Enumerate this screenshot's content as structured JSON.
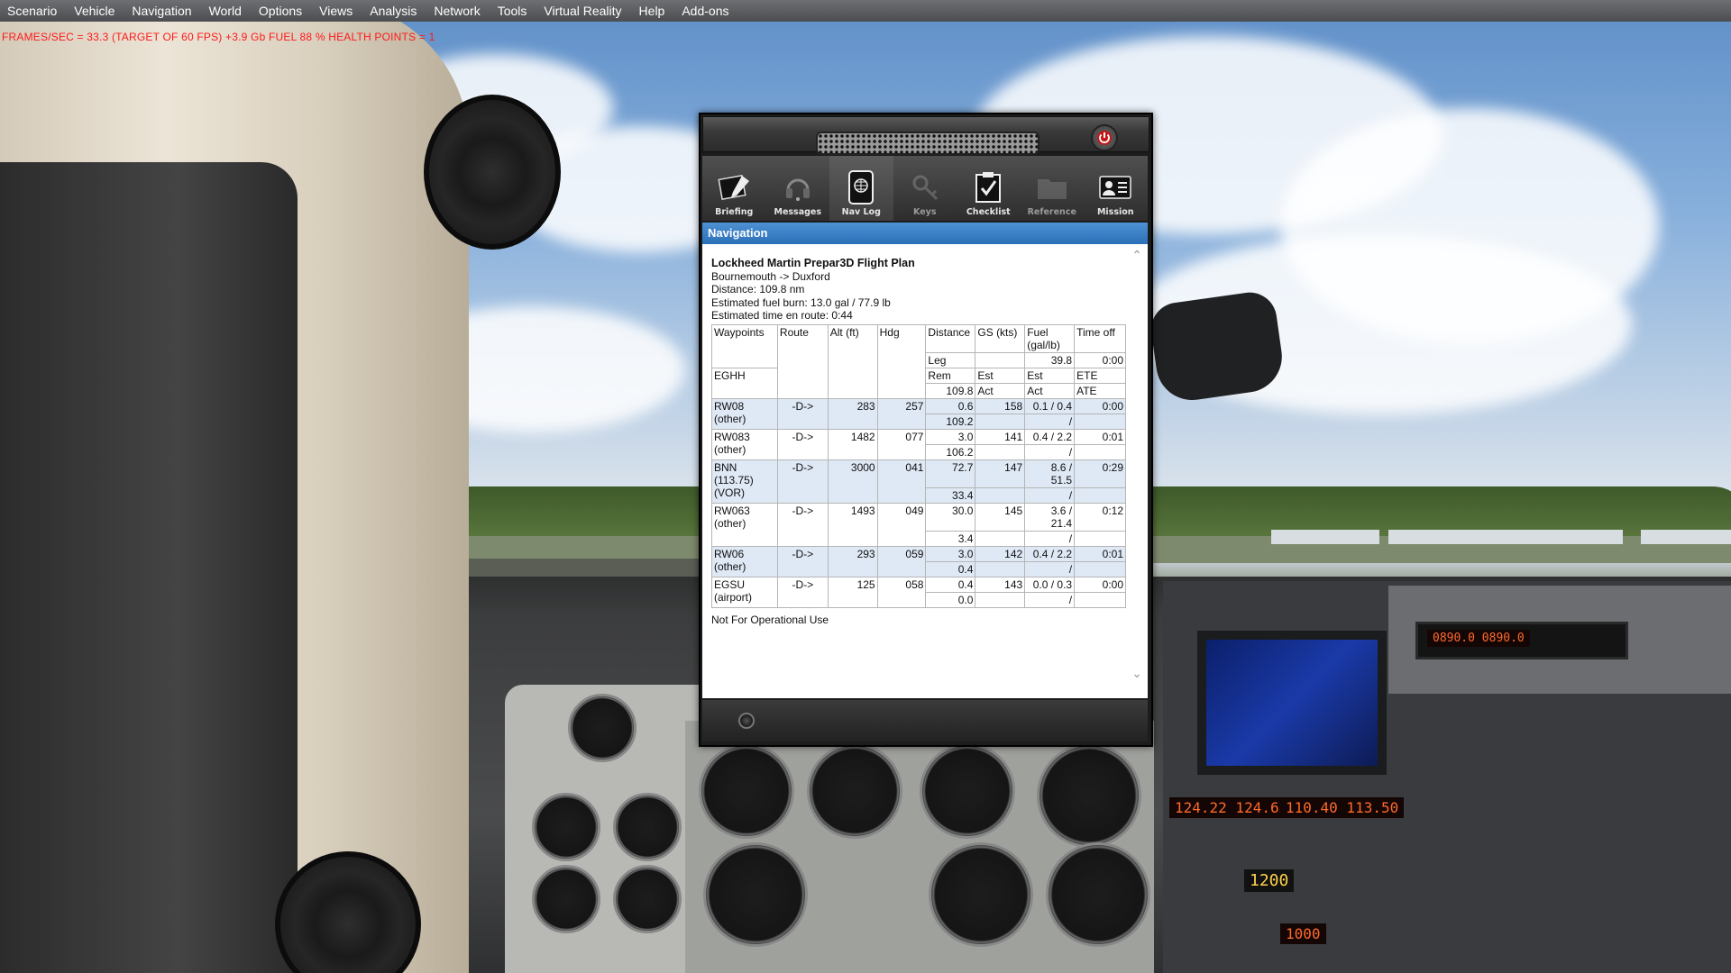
{
  "menubar": {
    "items": [
      "Scenario",
      "Vehicle",
      "Navigation",
      "World",
      "Options",
      "Views",
      "Analysis",
      "Network",
      "Tools",
      "Virtual Reality",
      "Help",
      "Add-ons"
    ]
  },
  "status_line": "FRAMES/SEC = 33.3   (TARGET OF 60 FPS)   +3.9 Gb   FUEL 88 %   HEALTH POINTS = 1",
  "colors": {
    "status_text": "#ff1a1a",
    "nav_header": "#2b6fb8",
    "led": "#ff6a2a"
  },
  "efb": {
    "toolbar": [
      {
        "label": "Briefing",
        "icon": "briefing-icon"
      },
      {
        "label": "Messages",
        "icon": "headset-icon"
      },
      {
        "label": "Nav Log",
        "icon": "tablet-globe-icon",
        "active": true
      },
      {
        "label": "Keys",
        "icon": "keys-icon",
        "dim": true
      },
      {
        "label": "Checklist",
        "icon": "checklist-icon"
      },
      {
        "label": "Reference",
        "icon": "folder-icon",
        "dim": true
      },
      {
        "label": "Mission",
        "icon": "id-card-icon"
      }
    ],
    "header": "Navigation",
    "flight_plan": {
      "title": "Lockheed Martin Prepar3D Flight Plan",
      "route": "Bournemouth -> Duxford",
      "distance": "Distance: 109.8 nm",
      "fuel_burn": "Estimated fuel burn: 13.0 gal / 77.9 lb",
      "ete": "Estimated time en route: 0:44",
      "columns": {
        "waypoints": "Waypoints",
        "route": "Route",
        "alt": "Alt (ft)",
        "hdg": "Hdg",
        "distance": "Distance",
        "gs": "GS (kts)",
        "fuel": "Fuel (gal/lb)",
        "time_off": "Time off"
      },
      "subheaders": {
        "leg": "Leg",
        "fuel_start": "39.8",
        "time_start": "0:00",
        "rem": "Rem",
        "est": "Est",
        "est2": "Est",
        "ete": "ETE",
        "rem_start": "109.8",
        "act": "Act",
        "act2": "Act",
        "ate": "ATE",
        "origin": "EGHH"
      },
      "rows": [
        {
          "wp": "RW08 (other)",
          "route": "-D->",
          "alt": "283",
          "hdg": "257",
          "leg": "0.6",
          "gs": "158",
          "fuel": "0.1 / 0.4",
          "ete": "0:00",
          "rem": "109.2",
          "fuel_act": "/"
        },
        {
          "wp": "RW083 (other)",
          "route": "-D->",
          "alt": "1482",
          "hdg": "077",
          "leg": "3.0",
          "gs": "141",
          "fuel": "0.4 / 2.2",
          "ete": "0:01",
          "rem": "106.2",
          "fuel_act": "/"
        },
        {
          "wp": "BNN (113.75) (VOR)",
          "route": "-D->",
          "alt": "3000",
          "hdg": "041",
          "leg": "72.7",
          "gs": "147",
          "fuel": "8.6 / 51.5",
          "ete": "0:29",
          "rem": "33.4",
          "fuel_act": "/"
        },
        {
          "wp": "RW063 (other)",
          "route": "-D->",
          "alt": "1493",
          "hdg": "049",
          "leg": "30.0",
          "gs": "145",
          "fuel": "3.6 / 21.4",
          "ete": "0:12",
          "rem": "3.4",
          "fuel_act": "/"
        },
        {
          "wp": "RW06 (other)",
          "route": "-D->",
          "alt": "293",
          "hdg": "059",
          "leg": "3.0",
          "gs": "142",
          "fuel": "0.4 / 2.2",
          "ete": "0:01",
          "rem": "0.4",
          "fuel_act": "/"
        },
        {
          "wp": "EGSU (airport)",
          "route": "-D->",
          "alt": "125",
          "hdg": "058",
          "leg": "0.4",
          "gs": "143",
          "fuel": "0.0 / 0.3",
          "ete": "0:00",
          "rem": "0.0",
          "fuel_act": "/"
        }
      ],
      "footer": "Not For Operational Use"
    }
  },
  "cockpit": {
    "com_display": "124.22  124.65",
    "nav_display": "110.40  113.50",
    "transponder": "1200",
    "adf_display": "0890.0   0890.0",
    "altitude_readout": "1000"
  }
}
